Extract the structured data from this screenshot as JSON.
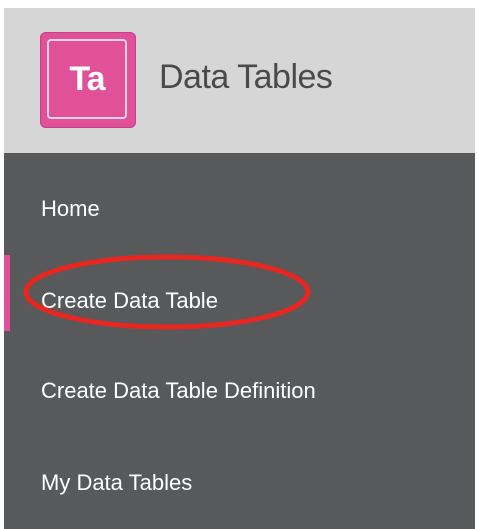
{
  "app": {
    "logo_text": "Ta",
    "title": "Data Tables",
    "logo_color": "#e0519a"
  },
  "nav": {
    "background_color": "#58595b",
    "active_item": "Create Data Table",
    "items": [
      {
        "label": "Home"
      },
      {
        "label": "Create Data Table"
      },
      {
        "label": "Create Data Table Definition"
      },
      {
        "label": "My Data Tables"
      }
    ]
  },
  "annotation": {
    "type": "red-ellipse",
    "color": "#e8261f",
    "target": "Create Data Table"
  }
}
